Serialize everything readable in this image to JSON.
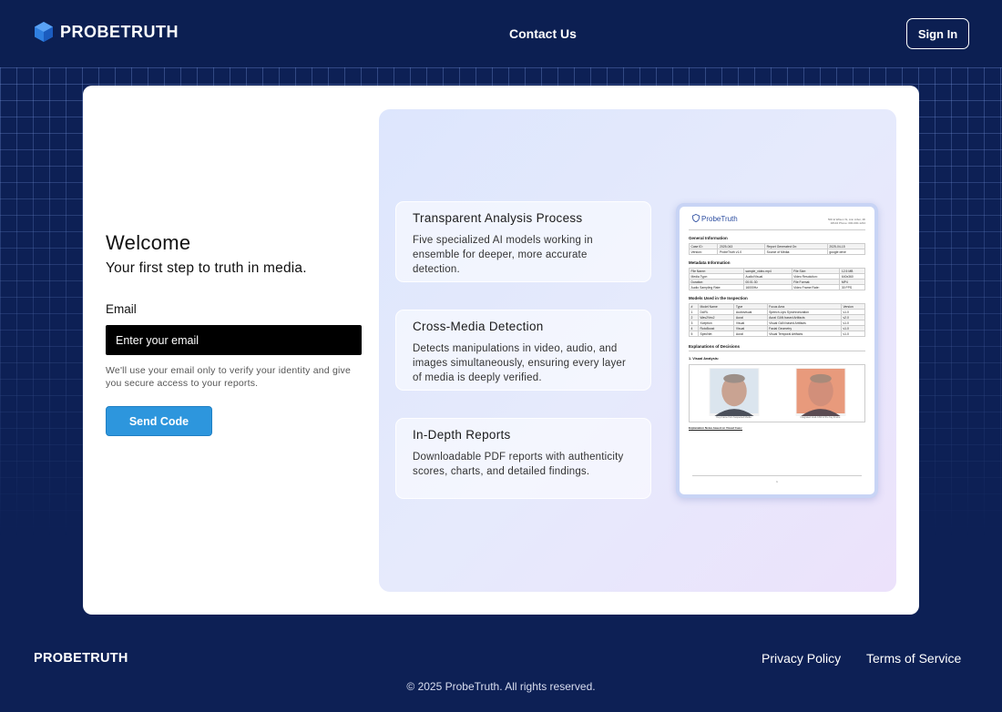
{
  "header": {
    "brand": "PROBETRUTH",
    "nav_contact": "Contact Us",
    "signin_label": "Sign In",
    "logo_icon": "hexagon-logo-icon",
    "logo_color": "#2f7fe0"
  },
  "login": {
    "title": "Welcome",
    "subtitle": "Your first step to truth in media.",
    "email_label": "Email",
    "email_placeholder": "Enter your email",
    "help_text": "We'll use your email only to verify your identity and give you secure access to your reports.",
    "send_button": "Send Code",
    "button_color": "#2d96dd"
  },
  "features": [
    {
      "title": "Transparent Analysis Process",
      "description": "Five specialized AI models working in ensemble for deeper, more accurate detection."
    },
    {
      "title": "Cross-Media Detection",
      "description": "Detects manipulations in video, audio, and images simultaneously, ensuring every layer of media is deeply verified."
    },
    {
      "title": "In-Depth Reports",
      "description": "Downloadable PDF reports with authenticity scores, charts, and detailed findings."
    }
  ],
  "report_preview": {
    "brand": "ProbeTruth",
    "address": "500 E Wilson St, Ann Arbor, MI 48104 Phone: 000-000-1234",
    "general_heading": "General Information",
    "general_rows": [
      [
        "Case ID:",
        "2025-043",
        "Report Generated On:",
        "2025-04-15"
      ],
      [
        "Version:",
        "ProbeTruth v1.0",
        "Source of Media:",
        "google drive"
      ]
    ],
    "metadata_heading": "Metadata Information",
    "metadata_rows": [
      [
        "File Name:",
        "sample_video.mp4",
        "File Size:",
        "12.5 MB"
      ],
      [
        "Media Type:",
        "Audio/Visual",
        "Video Resolution:",
        "640x360"
      ],
      [
        "Duration:",
        "00:01:30",
        "File Format:",
        "MP4"
      ],
      [
        "Audio Sampling Rate:",
        "16000Hz",
        "Video Frame Rate:",
        "30 FPS"
      ]
    ],
    "models_heading": "Models Used in the Inspection",
    "models_header": [
      "#",
      "Model Name",
      "Type",
      "Focus Area",
      "Version"
    ],
    "models_rows": [
      [
        "1",
        "DARL",
        "Audiovisual",
        "Speech-Lips Synchronization",
        "v1.0"
      ],
      [
        "2",
        "Wav2Vec2",
        "Aural",
        "Aural GAN based Artifacts",
        "v2.0"
      ],
      [
        "3",
        "Xception",
        "Visual",
        "Visual GAN based Artifacts",
        "v1.0"
      ],
      [
        "4",
        "RotoBoost",
        "Visual",
        "Facial Geometry",
        "v1.0"
      ],
      [
        "5",
        "SpecNet",
        "Aural",
        "Visual Temporal Artifacts",
        "v1.0"
      ]
    ],
    "decisions_heading": "Explanations of Decisions",
    "visual_heading": "1. Visual Analysis:",
    "image_caption_1": "Key Frame from Suspected Media",
    "image_caption_2": "Integrated Grad-CAM of the Key Frame",
    "notes_label": "Explanation Notes based on Visual Cues:",
    "page_number": "1"
  },
  "footer": {
    "brand": "PROBETRUTH",
    "privacy": "Privacy Policy",
    "terms": "Terms of Service",
    "copyright": "© 2025 ProbeTruth. All rights reserved."
  }
}
